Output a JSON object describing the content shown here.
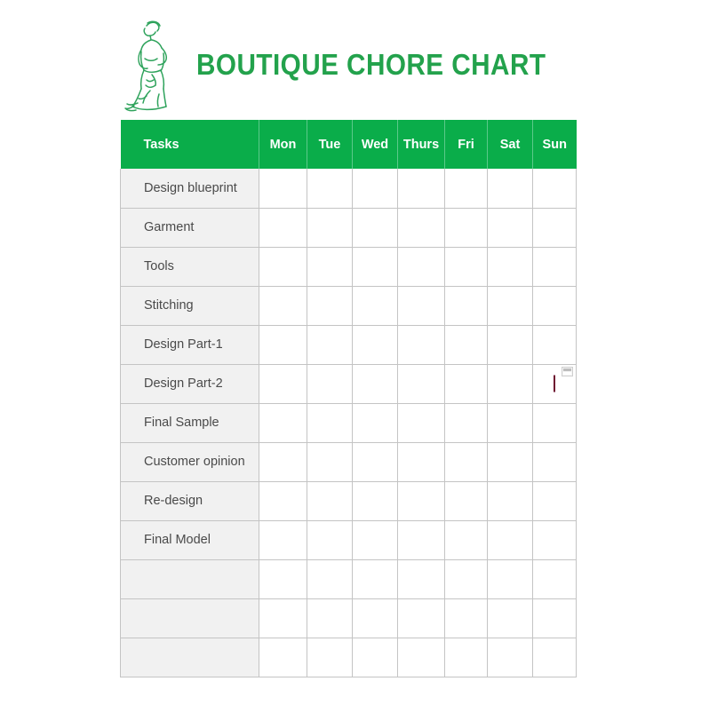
{
  "header": {
    "title": "BOUTIQUE CHORE CHART",
    "logo_icon": "fashion-dress-sketch-icon",
    "brand_color": "#23a24c"
  },
  "table": {
    "header_bg_color": "#0aad4a",
    "task_column_bg_color": "#f1f1f1",
    "border_color": "#c4c4c4",
    "columns": [
      {
        "key": "task",
        "label": "Tasks"
      },
      {
        "key": "mon",
        "label": "Mon"
      },
      {
        "key": "tue",
        "label": "Tue"
      },
      {
        "key": "wed",
        "label": "Wed"
      },
      {
        "key": "thu",
        "label": "Thurs"
      },
      {
        "key": "fri",
        "label": "Fri"
      },
      {
        "key": "sat",
        "label": "Sat"
      },
      {
        "key": "sun",
        "label": "Sun"
      }
    ],
    "rows": [
      {
        "task": "Design blueprint",
        "mon": "",
        "tue": "",
        "wed": "",
        "thu": "",
        "fri": "",
        "sat": "",
        "sun": ""
      },
      {
        "task": "Garment",
        "mon": "",
        "tue": "",
        "wed": "",
        "thu": "",
        "fri": "",
        "sat": "",
        "sun": ""
      },
      {
        "task": "Tools",
        "mon": "",
        "tue": "",
        "wed": "",
        "thu": "",
        "fri": "",
        "sat": "",
        "sun": ""
      },
      {
        "task": "Stitching",
        "mon": "",
        "tue": "",
        "wed": "",
        "thu": "",
        "fri": "",
        "sat": "",
        "sun": ""
      },
      {
        "task": "Design Part-1",
        "mon": "",
        "tue": "",
        "wed": "",
        "thu": "",
        "fri": "",
        "sat": "",
        "sun": ""
      },
      {
        "task": "Design Part-2",
        "mon": "",
        "tue": "",
        "wed": "",
        "thu": "",
        "fri": "",
        "sat": "",
        "sun": ""
      },
      {
        "task": "Final Sample",
        "mon": "",
        "tue": "",
        "wed": "",
        "thu": "",
        "fri": "",
        "sat": "",
        "sun": ""
      },
      {
        "task": "Customer opinion",
        "mon": "",
        "tue": "",
        "wed": "",
        "thu": "",
        "fri": "",
        "sat": "",
        "sun": ""
      },
      {
        "task": "Re-design",
        "mon": "",
        "tue": "",
        "wed": "",
        "thu": "",
        "fri": "",
        "sat": "",
        "sun": ""
      },
      {
        "task": "Final Model",
        "mon": "",
        "tue": "",
        "wed": "",
        "thu": "",
        "fri": "",
        "sat": "",
        "sun": ""
      },
      {
        "task": "",
        "mon": "",
        "tue": "",
        "wed": "",
        "thu": "",
        "fri": "",
        "sat": "",
        "sun": ""
      },
      {
        "task": "",
        "mon": "",
        "tue": "",
        "wed": "",
        "thu": "",
        "fri": "",
        "sat": "",
        "sun": ""
      },
      {
        "task": "",
        "mon": "",
        "tue": "",
        "wed": "",
        "thu": "",
        "fri": "",
        "sat": "",
        "sun": ""
      }
    ]
  },
  "cursor": {
    "caret_row_index": 5,
    "caret_column_key": "sun",
    "caret_color": "#6e1230",
    "handle_icon": "table-cell-handle-icon"
  }
}
